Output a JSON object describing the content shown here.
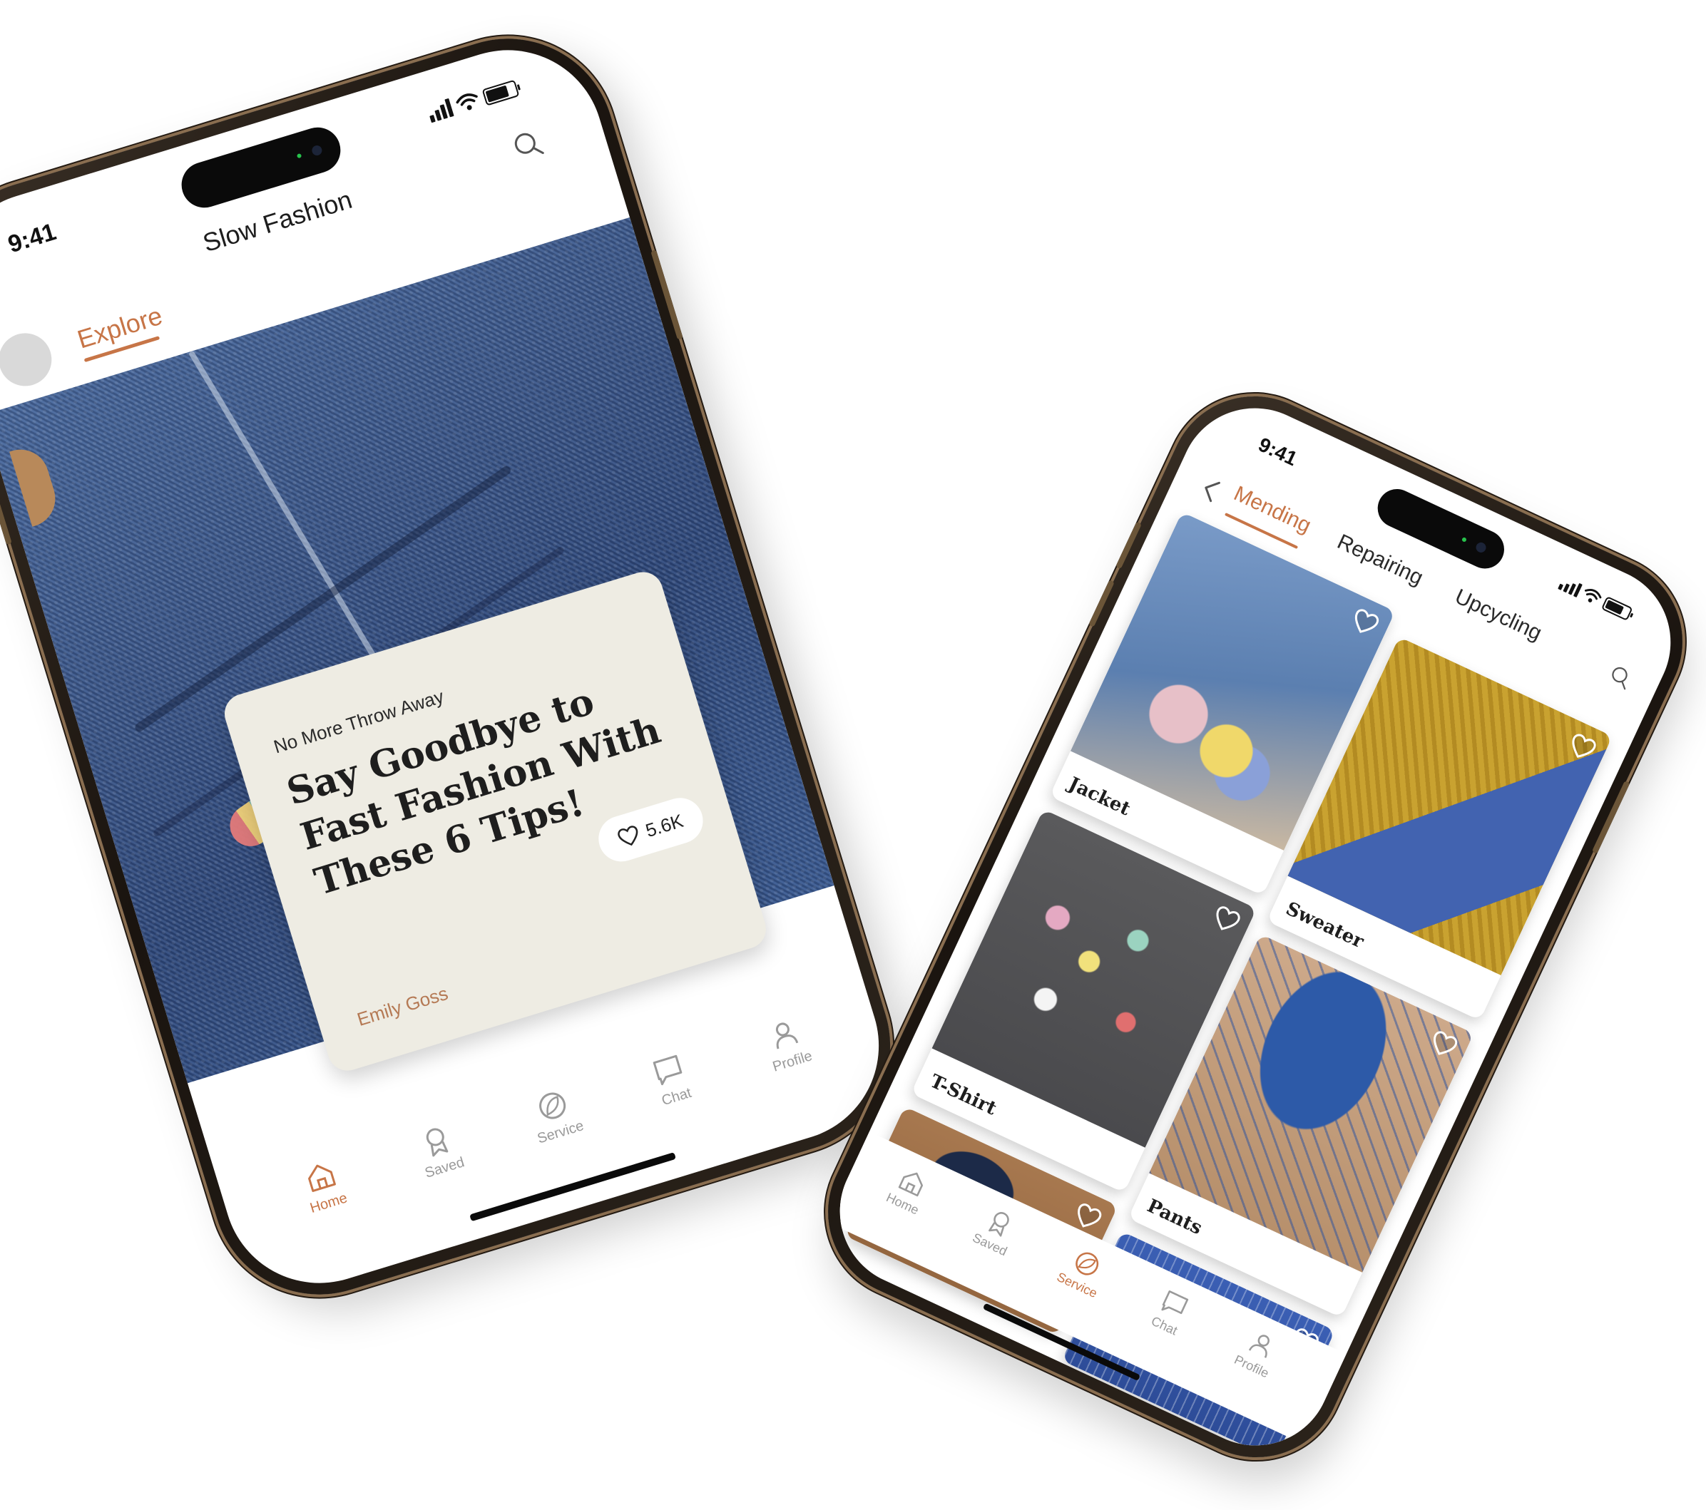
{
  "phone1": {
    "status": {
      "time": "9:41"
    },
    "header": {
      "title": "Slow Fashion",
      "tab_active": "Explore"
    },
    "article": {
      "kicker": "No More Throw Away",
      "headline": "Say Goodbye to Fast Fashion With These 6 Tips!",
      "likes": "5.6K",
      "author": "Emily Goss"
    },
    "nav": {
      "home": "Home",
      "saved": "Saved",
      "service": "Service",
      "chat": "Chat",
      "profile": "Profile",
      "active": "Home"
    }
  },
  "phone2": {
    "status": {
      "time": "9:41"
    },
    "tabs": [
      "Mending",
      "Repairing",
      "Upcycling"
    ],
    "tab_active": "Mending",
    "tiles": [
      {
        "label": "Jacket"
      },
      {
        "label": "Sweater"
      },
      {
        "label": "T-Shirt"
      },
      {
        "label": "Pants"
      }
    ],
    "nav": {
      "home": "Home",
      "saved": "Saved",
      "service": "Service",
      "chat": "Chat",
      "profile": "Profile",
      "active": "Service"
    }
  },
  "colors": {
    "accent": "#c77547",
    "card_bg": "#eeece3",
    "nav_inactive": "#9a9a9a",
    "frame": "#2b231b"
  }
}
